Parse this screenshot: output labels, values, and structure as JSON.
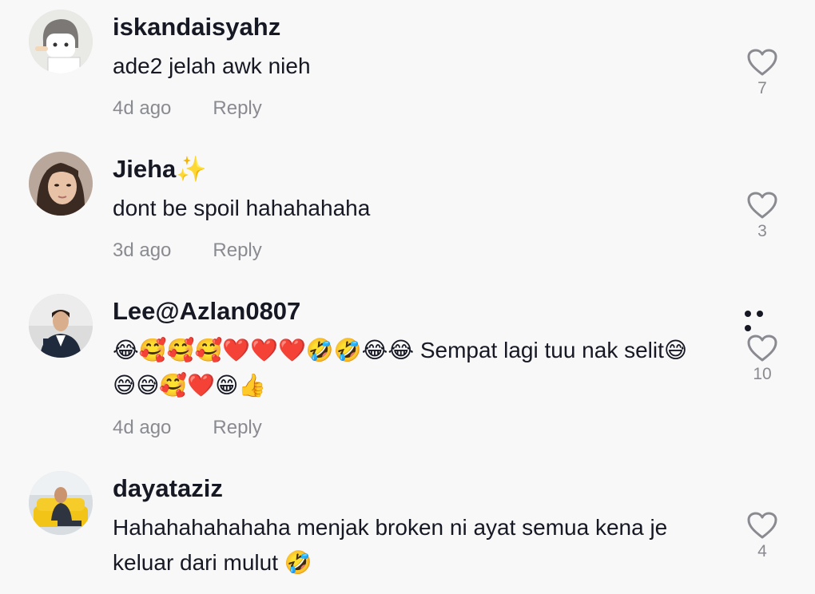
{
  "comments": [
    {
      "username": "iskandaisyahz",
      "text": "ade2 jelah awk nieh",
      "time": "4d ago",
      "reply_label": "Reply",
      "likes": "7",
      "avatar_icon": "cartoon-character-avatar"
    },
    {
      "username": "Jieha✨",
      "text": "dont be spoil hahahahaha",
      "time": "3d ago",
      "reply_label": "Reply",
      "likes": "3",
      "avatar_icon": "woman-photo-avatar"
    },
    {
      "username": "Lee@Azlan0807",
      "text": "😂🥰🥰🥰❤️❤️❤️🤣🤣😂😂 Sempat lagi tuu nak selit😅😅😅🥰❤️😁👍",
      "time": "4d ago",
      "reply_label": "Reply",
      "likes": "10",
      "avatar_icon": "man-in-suit-avatar",
      "more_icon": "more-options-icon"
    },
    {
      "username": "dayataziz",
      "text": "Hahahahahahaha menjak broken ni ayat semua kena je keluar dari mulut 🤣",
      "likes": "4",
      "avatar_icon": "man-on-yellow-couch-avatar"
    }
  ],
  "colors": {
    "background": "#f8f8f8",
    "primary_text": "#161823",
    "secondary_text": "#8a8b91",
    "heart_stroke": "#8a8b91"
  }
}
